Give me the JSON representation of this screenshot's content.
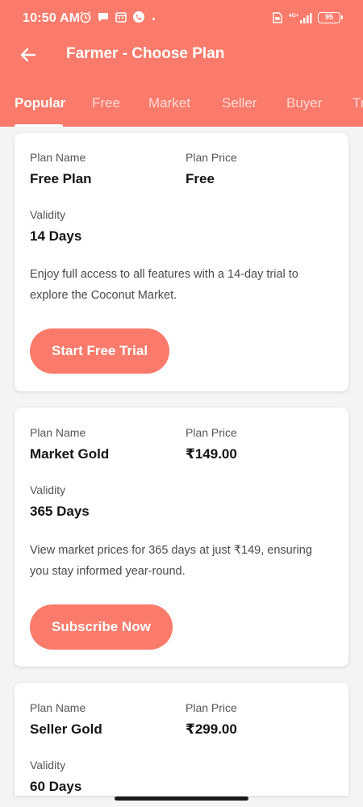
{
  "theme": {
    "accent": "#fa7b6b"
  },
  "status_bar": {
    "time": "10:50 AM",
    "battery": "95",
    "icons_left": [
      "alarm-icon",
      "chat-icon",
      "calendar-icon",
      "call-icon"
    ],
    "icons_right": [
      "sim-icon",
      "signal-icon"
    ]
  },
  "app_bar": {
    "title": "Farmer - Choose Plan",
    "back_icon": "back-arrow-icon"
  },
  "tabs": [
    {
      "label": "Popular",
      "active": true
    },
    {
      "label": "Free",
      "active": false
    },
    {
      "label": "Market",
      "active": false
    },
    {
      "label": "Seller",
      "active": false
    },
    {
      "label": "Buyer",
      "active": false
    },
    {
      "label": "Tr",
      "active": false
    }
  ],
  "plans": [
    {
      "name_label": "Plan Name",
      "name": "Free Plan",
      "price_label": "Plan Price",
      "price": "Free",
      "validity_label": "Validity",
      "validity": "14 Days",
      "description": "Enjoy full access to all features with a 14-day trial to explore the Coconut Market.",
      "button": "Start Free Trial"
    },
    {
      "name_label": "Plan Name",
      "name": "Market Gold",
      "price_label": "Plan Price",
      "price": "₹149.00",
      "validity_label": "Validity",
      "validity": "365 Days",
      "description": "View market prices for 365 days at just ₹149, ensuring you stay informed year-round.",
      "button": "Subscribe Now"
    },
    {
      "name_label": "Plan Name",
      "name": "Seller Gold",
      "price_label": "Plan Price",
      "price": "₹299.00",
      "validity_label": "Validity",
      "validity": "60 Days"
    }
  ]
}
